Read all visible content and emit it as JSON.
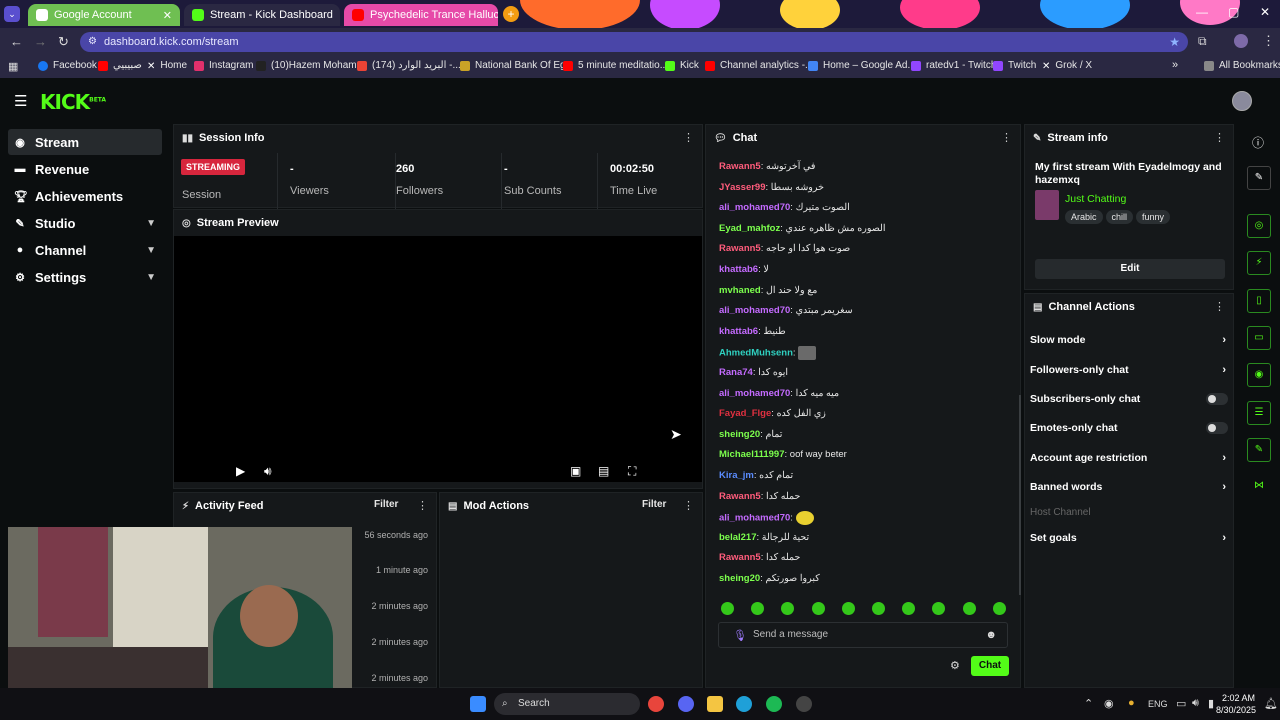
{
  "browser": {
    "tabs": [
      {
        "label": "Google Account",
        "color": "#ea4335"
      },
      {
        "label": "Stream - Kick Dashboard",
        "color": "#53fc18"
      },
      {
        "label": "Psychedelic Trance Hallucinatio",
        "color": "#ff0000"
      }
    ],
    "url": "dashboard.kick.com/stream",
    "bookmarks": [
      {
        "label": "Facebook",
        "color": "#1877f2"
      },
      {
        "label": "صبيبيي",
        "color": "#ff0000"
      },
      {
        "label": "Home",
        "color": "#ffffff"
      },
      {
        "label": "Instagram",
        "color": "#e1306c"
      },
      {
        "label": "(10)Hazem Moham...",
        "color": "#ffffff"
      },
      {
        "label": "(174) البريد الوارد -...",
        "color": "#ea4335"
      },
      {
        "label": "National Bank Of Eg...",
        "color": "#c9a227"
      },
      {
        "label": "5 minute meditatio...",
        "color": "#ff0000"
      },
      {
        "label": "Kick",
        "color": "#53fc18"
      },
      {
        "label": "Channel analytics -...",
        "color": "#ff0000"
      },
      {
        "label": "Home – Google Ad...",
        "color": "#4285f4"
      },
      {
        "label": "ratedv1 - Twitch",
        "color": "#9146ff"
      },
      {
        "label": "Twitch",
        "color": "#9146ff"
      },
      {
        "label": "Grok / X",
        "color": "#ffffff"
      }
    ],
    "all_bookmarks": "All Bookmarks"
  },
  "kick": {
    "logo": "KICK",
    "logo_sup": "BETA",
    "accent": "#53fc18"
  },
  "sidebar": {
    "items": [
      {
        "label": "Stream",
        "icon": "broadcast-icon"
      },
      {
        "label": "Revenue",
        "icon": "wallet-icon"
      },
      {
        "label": "Achievements",
        "icon": "trophy-icon"
      },
      {
        "label": "Studio",
        "icon": "studio-icon"
      },
      {
        "label": "Channel",
        "icon": "user-icon"
      },
      {
        "label": "Settings",
        "icon": "gear-icon"
      }
    ]
  },
  "session": {
    "title": "Session Info",
    "badge": "STREAMING",
    "stats": [
      {
        "value": "",
        "label": "Session"
      },
      {
        "value": "-",
        "label": "Viewers"
      },
      {
        "value": "260",
        "label": "Followers"
      },
      {
        "value": "-",
        "label": "Sub Counts"
      },
      {
        "value": "00:02:50",
        "label": "Time Live"
      }
    ]
  },
  "preview": {
    "title": "Stream Preview"
  },
  "activity": {
    "title": "Activity Feed",
    "filter": "Filter",
    "times": [
      "56 seconds ago",
      "1 minute ago",
      "2 minutes ago",
      "2 minutes ago",
      "2 minutes ago"
    ]
  },
  "mod": {
    "title": "Mod Actions",
    "filter": "Filter"
  },
  "chat": {
    "title": "Chat",
    "messages": [
      {
        "user": "Rawann5",
        "text": "في آخرتوشه",
        "color": "#ff5c7c"
      },
      {
        "user": "JYasser99",
        "text": "خروشه بسطا",
        "color": "#ff5c7c"
      },
      {
        "user": "ali_mohamed70",
        "text": "الصوت متيرك",
        "color": "#c46bff"
      },
      {
        "user": "Eyad_mahfoz",
        "text": "الصوره مش ظاهره عندي",
        "color": "#7cff4d"
      },
      {
        "user": "Rawann5",
        "text": "صوت هوا كدا او حاجه",
        "color": "#ff5c7c"
      },
      {
        "user": "khattab6",
        "text": "لا",
        "color": "#c46bff"
      },
      {
        "user": "mvhaned",
        "text": "مع ولا حند ال",
        "color": "#7cff4d"
      },
      {
        "user": "ali_mohamed70",
        "text": "سغريمر مبتدي",
        "color": "#c46bff"
      },
      {
        "user": "khattab6",
        "text": "طنيط",
        "color": "#c46bff"
      },
      {
        "user": "AhmedMuhsenn",
        "text": "",
        "color": "#2fd0c0"
      },
      {
        "user": "Rana74",
        "text": "ايوه كدا",
        "color": "#c46bff"
      },
      {
        "user": "ali_mohamed70",
        "text": "ميه ميه كدا",
        "color": "#c46bff"
      },
      {
        "user": "Fayad_Flge",
        "text": "زي الفل كده",
        "color": "#e03040"
      },
      {
        "user": "sheing20",
        "text": "تمام",
        "color": "#7cff4d"
      },
      {
        "user": "Michael111997",
        "text": "oof way beter",
        "color": "#7cff4d"
      },
      {
        "user": "Kira_jm",
        "text": "تمام كده",
        "color": "#5a8cff"
      },
      {
        "user": "Rawann5",
        "text": "حمله كدا",
        "color": "#ff5c7c"
      },
      {
        "user": "ali_mohamed70",
        "text": "",
        "color": "#c46bff"
      },
      {
        "user": "belal217",
        "text": "تحية للرجالة",
        "color": "#7cff4d"
      },
      {
        "user": "Rawann5",
        "text": "حمله كدا",
        "color": "#ff5c7c"
      },
      {
        "user": "sheing20",
        "text": "كبروا صورتكم",
        "color": "#7cff4d"
      }
    ],
    "placeholder": "Send a message",
    "send_label": "Chat"
  },
  "stream_info": {
    "title": "Stream info",
    "stream_title": "My first stream With Eyadelmogy and hazemxq",
    "category": "Just Chatting",
    "tags": [
      "Arabic",
      "chill",
      "funny"
    ],
    "edit": "Edit"
  },
  "channel_actions": {
    "title": "Channel Actions",
    "items": [
      {
        "label": "Slow mode",
        "kind": "arrow"
      },
      {
        "label": "Followers-only chat",
        "kind": "arrow"
      },
      {
        "label": "Subscribers-only chat",
        "kind": "toggle",
        "on": false
      },
      {
        "label": "Emotes-only chat",
        "kind": "toggle",
        "on": false
      },
      {
        "label": "Account age restriction",
        "kind": "arrow"
      },
      {
        "label": "Banned words",
        "kind": "arrow"
      },
      {
        "label": "Host Channel",
        "kind": "disabled"
      },
      {
        "label": "Set goals",
        "kind": "arrow"
      }
    ]
  },
  "taskbar": {
    "search": "Search",
    "lang": "ENG",
    "time": "2:02 AM",
    "date": "8/30/2025"
  }
}
